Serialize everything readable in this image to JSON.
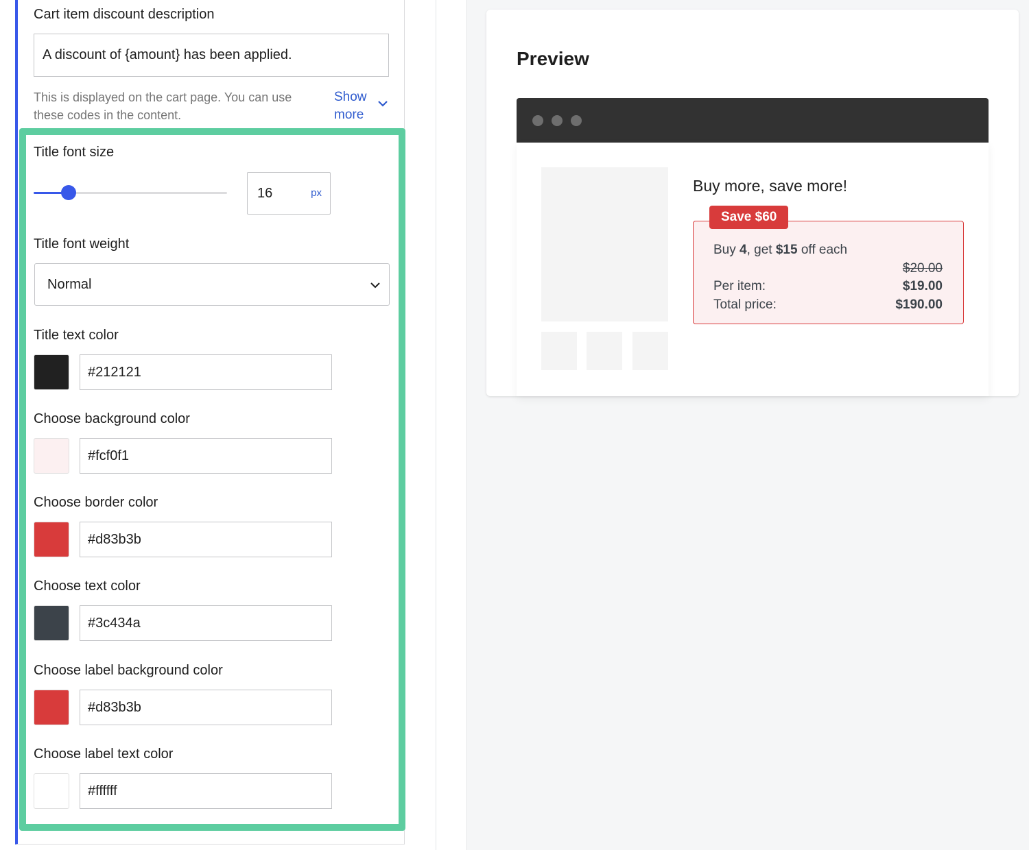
{
  "settings": {
    "cart_item": {
      "label": "Cart item discount description",
      "value": "A discount of {amount} has been applied.",
      "help": "This is displayed on the cart page. You can use these codes in the content.",
      "show_more": "Show more"
    },
    "title_font_size": {
      "label": "Title font size",
      "value": "16",
      "unit": "px",
      "slider_fraction": 0.18
    },
    "title_font_weight": {
      "label": "Title font weight",
      "selected": "Normal"
    },
    "colors": [
      {
        "label": "Title text color",
        "value": "#212121"
      },
      {
        "label": "Choose background color",
        "value": "#fcf0f1"
      },
      {
        "label": "Choose border color",
        "value": "#d83b3b"
      },
      {
        "label": "Choose text color",
        "value": "#3c434a"
      },
      {
        "label": "Choose label background color",
        "value": "#d83b3b"
      },
      {
        "label": "Choose label text color",
        "value": "#ffffff"
      }
    ]
  },
  "preview": {
    "heading": "Preview",
    "product_title": "Buy more, save more!",
    "offer": {
      "label": "Save $60",
      "desc_prefix": "Buy ",
      "desc_qty": "4",
      "desc_mid": ", get ",
      "desc_amount": "$15",
      "desc_suffix": " off each",
      "original_price": "$20.00",
      "per_item_label": "Per item:",
      "per_item_value": "$19.00",
      "total_label": "Total price:",
      "total_value": "$190.00"
    }
  },
  "theme": {
    "accent": "#3858e9",
    "link": "#2f5bce",
    "highlight": "#5dcda0"
  }
}
